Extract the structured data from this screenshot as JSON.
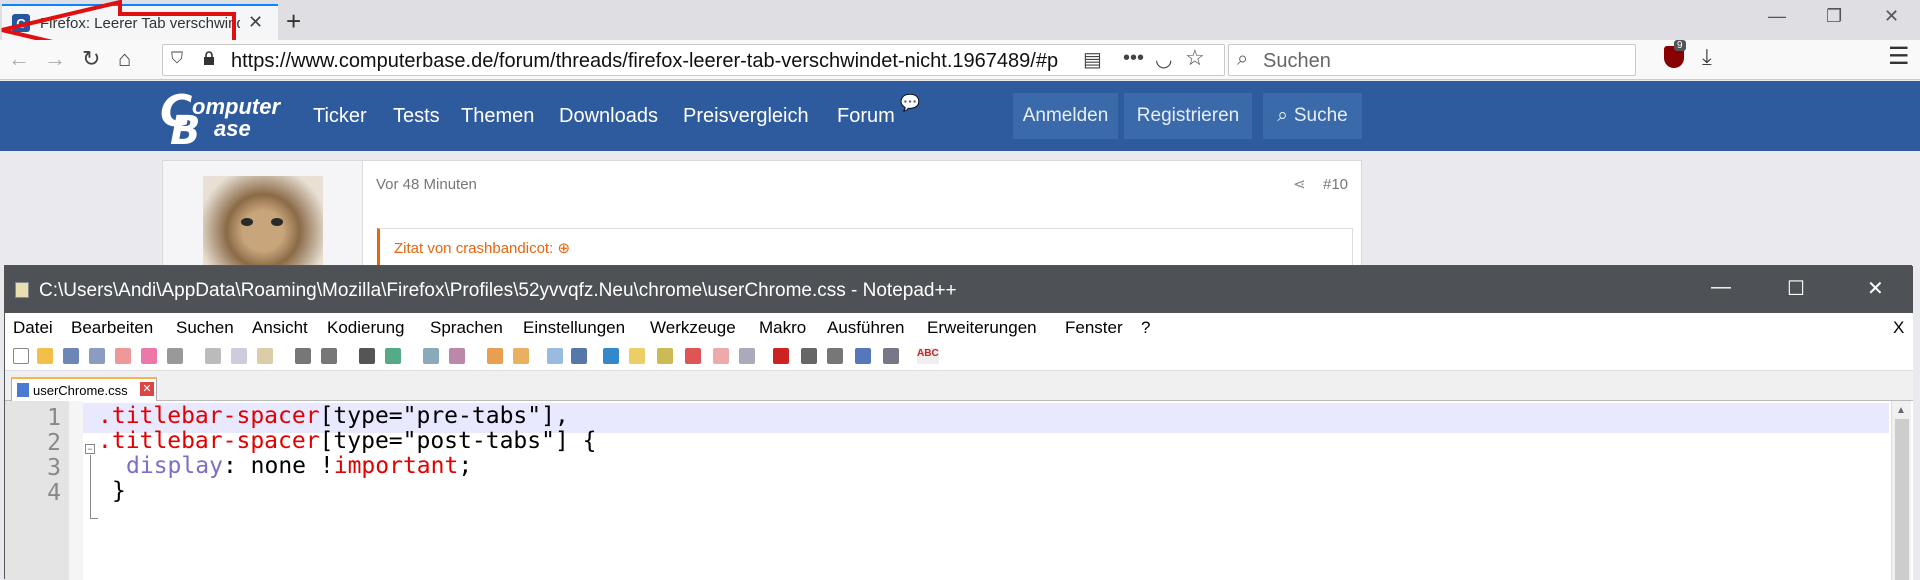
{
  "firefox": {
    "tab_title": "Firefox: Leerer Tab verschwindet nicht",
    "favicon_letter": "C",
    "url": "https://www.computerbase.de/forum/threads/firefox-leerer-tab-verschwindet-nicht.1967489/#p",
    "search_placeholder": "Suchen",
    "ublock_badge": "9"
  },
  "site": {
    "logo_top": "omputer",
    "logo_bottom": "ase",
    "logo_c": "C",
    "logo_b": "B",
    "nav": [
      "Ticker",
      "Tests",
      "Themen",
      "Downloads",
      "Preisvergleich",
      "Forum"
    ],
    "login": "Anmelden",
    "register": "Registrieren",
    "search": "Suche",
    "brand_color": "#2e5b9d"
  },
  "post": {
    "time": "Vor 48 Minuten",
    "number": "#10",
    "quote_author": "Zitat von crashbandicot:"
  },
  "npp": {
    "title": "C:\\Users\\Andi\\AppData\\Roaming\\Mozilla\\Firefox\\Profiles\\52yvvqfz.Neu\\chrome\\userChrome.css - Notepad++",
    "menu": [
      "Datei",
      "Bearbeiten",
      "Suchen",
      "Ansicht",
      "Kodierung",
      "Sprachen",
      "Einstellungen",
      "Werkzeuge",
      "Makro",
      "Ausführen",
      "Erweiterungen",
      "Fenster",
      "?"
    ],
    "menu_close": "X",
    "file_tab": "userChrome.css",
    "lines": [
      {
        "no": "1",
        "sel": ".titlebar-spacer",
        "rest": "[type=\"pre-tabs\"],"
      },
      {
        "no": "2",
        "sel": ".titlebar-spacer",
        "rest": "[type=\"post-tabs\"] {"
      },
      {
        "no": "3",
        "prop": "display",
        "value": ": none !",
        "imp": "important",
        "end": ";"
      },
      {
        "no": "4",
        "close": "}"
      }
    ]
  }
}
